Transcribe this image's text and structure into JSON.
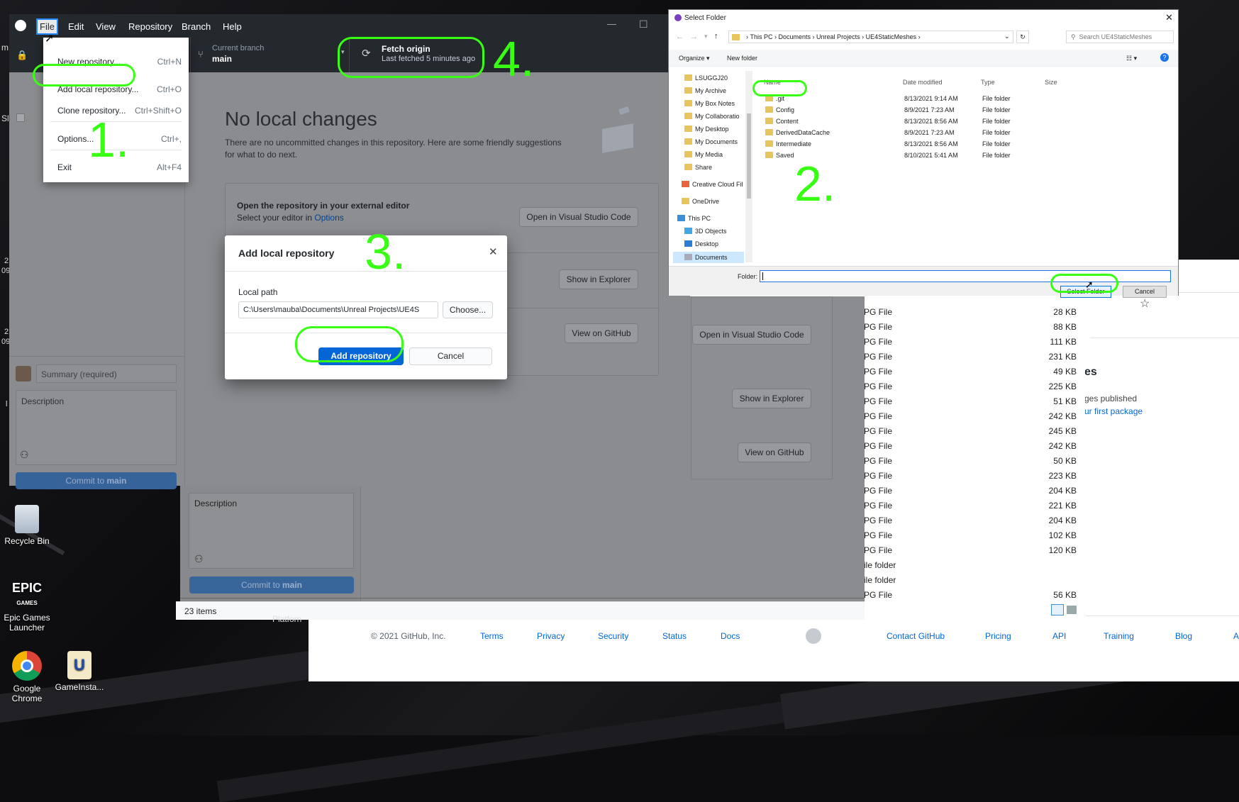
{
  "steps": {
    "s1": "1.",
    "s2": "2.",
    "s3": "3.",
    "s4": "4."
  },
  "desktop": {
    "icons": [
      "Recycle Bin",
      "Epic Games Launcher",
      "Google Chrome",
      "GameInsta..."
    ],
    "epic_logo_top": "EPIC",
    "epic_logo_bottom": "GAMES",
    "edge_chars": [
      "m",
      "Sl",
      "2",
      "09",
      "2",
      "09",
      "l"
    ],
    "platform_text": "Platforn"
  },
  "github_desktop": {
    "menu": [
      "File",
      "Edit",
      "View",
      "Repository",
      "Branch",
      "Help"
    ],
    "file_menu": [
      {
        "label": "New repository...",
        "shortcut": "Ctrl+N"
      },
      {
        "label": "Add local repository...",
        "shortcut": "Ctrl+O"
      },
      {
        "label": "Clone repository...",
        "shortcut": "Ctrl+Shift+O"
      },
      {
        "label": "Options...",
        "shortcut": "Ctrl+,"
      },
      {
        "label": "Exit",
        "shortcut": "Alt+F4"
      }
    ],
    "branch_label": "Current branch",
    "branch_value": "main",
    "fetch_label": "Fetch origin",
    "fetch_sub": "Last fetched 5 minutes ago",
    "no_changes_title": "No local changes",
    "no_changes_desc": "There are no uncommitted changes in this repository. Here are some friendly suggestions for what to do next.",
    "suggestion_title": "Open the repository in your external editor",
    "suggestion_sub": "Select your editor in ",
    "suggestion_link": "Options",
    "buttons": {
      "open_vscode": "Open in Visual Studio Code",
      "show_explorer": "Show in Explorer",
      "view_github": "View on GitHub"
    },
    "summary_placeholder": "Summary (required)",
    "description_placeholder": "Description",
    "commit_prefix": "Commit to ",
    "commit_branch": "main"
  },
  "add_local_modal": {
    "title": "Add local repository",
    "path_label": "Local path",
    "path_value": "C:\\Users\\mauba\\Documents\\Unreal Projects\\UE4S",
    "choose": "Choose...",
    "add": "Add repository",
    "cancel": "Cancel"
  },
  "select_folder": {
    "title": "Select Folder",
    "breadcrumb": [
      "This PC",
      "Documents",
      "Unreal Projects",
      "UE4StaticMeshes"
    ],
    "search_placeholder": "Search UE4StaticMeshes",
    "organize": "Organize",
    "new_folder": "New folder",
    "columns": [
      "Name",
      "Date modified",
      "Type",
      "Size"
    ],
    "tree": [
      "LSUGGJ20",
      "My Archive",
      "My Box Notes",
      "My Collaboratio",
      "My Desktop",
      "My Documents",
      "My Media",
      "Share",
      "Creative Cloud Fil",
      "OneDrive",
      "This PC",
      "3D Objects",
      "Desktop",
      "Documents"
    ],
    "files": [
      {
        "name": ".git",
        "date": "8/13/2021 9:14 AM",
        "type": "File folder"
      },
      {
        "name": "Config",
        "date": "8/9/2021 7:23 AM",
        "type": "File folder"
      },
      {
        "name": "Content",
        "date": "8/13/2021 8:56 AM",
        "type": "File folder"
      },
      {
        "name": "DerivedDataCache",
        "date": "8/9/2021 7:23 AM",
        "type": "File folder"
      },
      {
        "name": "Intermediate",
        "date": "8/13/2021 8:56 AM",
        "type": "File folder"
      },
      {
        "name": "Saved",
        "date": "8/10/2021 5:41 AM",
        "type": "File folder"
      }
    ],
    "folder_label": "Folder:",
    "select_btn": "Select Folder",
    "cancel_btn": "Cancel"
  },
  "explorer_list": {
    "rows": [
      {
        "type": "PG File",
        "size": "28 KB"
      },
      {
        "type": "PG File",
        "size": "88 KB"
      },
      {
        "type": "PG File",
        "size": "111 KB"
      },
      {
        "type": "PG File",
        "size": "231 KB"
      },
      {
        "type": "PG File",
        "size": "49 KB"
      },
      {
        "type": "PG File",
        "size": "225 KB"
      },
      {
        "type": "PG File",
        "size": "51 KB"
      },
      {
        "type": "PG File",
        "size": "242 KB"
      },
      {
        "type": "PG File",
        "size": "245 KB"
      },
      {
        "type": "PG File",
        "size": "242 KB"
      },
      {
        "type": "PG File",
        "size": "50 KB"
      },
      {
        "type": "PG File",
        "size": "223 KB"
      },
      {
        "type": "PG File",
        "size": "204 KB"
      },
      {
        "type": "PG File",
        "size": "221 KB"
      },
      {
        "type": "PG File",
        "size": "204 KB"
      },
      {
        "type": "PG File",
        "size": "102 KB"
      },
      {
        "type": "PG File",
        "size": "120 KB"
      },
      {
        "type": "ile folder",
        "size": ""
      },
      {
        "type": "ile folder",
        "size": ""
      },
      {
        "type": "PG File",
        "size": "56 KB"
      }
    ],
    "item_count": "23 items"
  },
  "web": {
    "partial_heading": "es",
    "partial_text": "ges published",
    "partial_link": "ur first package",
    "footer": [
      "© 2021 GitHub, Inc.",
      "Terms",
      "Privacy",
      "Security",
      "Status",
      "Docs",
      "Contact GitHub",
      "Pricing",
      "API",
      "Training",
      "Blog",
      "A"
    ]
  }
}
